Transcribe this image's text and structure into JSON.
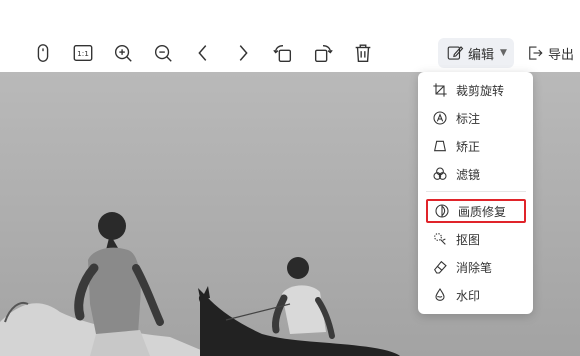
{
  "toolbar": {
    "tools": [
      {
        "icon": "mouse-icon",
        "label": ""
      },
      {
        "icon": "actual-size-icon",
        "label": "1:1"
      },
      {
        "icon": "zoom-in-icon",
        "label": ""
      },
      {
        "icon": "zoom-out-icon",
        "label": ""
      },
      {
        "icon": "previous-icon",
        "label": ""
      },
      {
        "icon": "next-icon",
        "label": ""
      },
      {
        "icon": "rotate-left-icon",
        "label": ""
      },
      {
        "icon": "rotate-right-icon",
        "label": ""
      },
      {
        "icon": "delete-icon",
        "label": ""
      }
    ],
    "edit_label": "编辑",
    "export_label": "导出"
  },
  "menu": {
    "items": [
      {
        "label": "裁剪旋转",
        "icon": "crop-icon"
      },
      {
        "label": "标注",
        "icon": "annotate-icon"
      },
      {
        "label": "矫正",
        "icon": "correct-icon"
      },
      {
        "label": "滤镜",
        "icon": "filter-icon"
      },
      {
        "label": "画质修复",
        "icon": "quality-repair-icon",
        "highlighted": true
      },
      {
        "label": "抠图",
        "icon": "cutout-icon"
      },
      {
        "label": "消除笔",
        "icon": "eraser-icon"
      },
      {
        "label": "水印",
        "icon": "watermark-icon"
      }
    ]
  },
  "colors": {
    "highlight_border": "#e0242a",
    "edit_button_bg": "#eef0f4"
  }
}
